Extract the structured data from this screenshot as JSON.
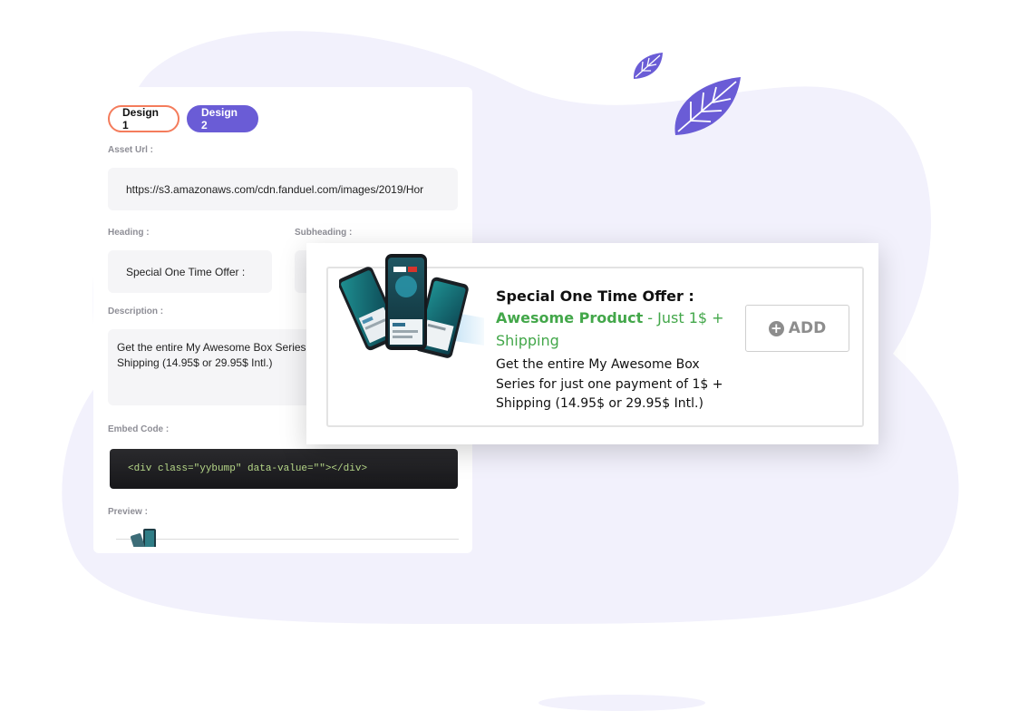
{
  "colors": {
    "accent_purple": "#6a5cd6",
    "tab_outline": "#f47c5c",
    "offer_green": "#43a74a",
    "blob_background": "#f2f1fc"
  },
  "editor": {
    "tabs": [
      {
        "label": "Design 1",
        "active": false
      },
      {
        "label": "Design 2",
        "active": true
      }
    ],
    "asset_url": {
      "label": "Asset Url :",
      "value": "https://s3.amazonaws.com/cdn.fanduel.com/images/2019/Hor"
    },
    "heading": {
      "label": "Heading :",
      "value": "Special One Time Offer :"
    },
    "subheading": {
      "label": "Subheading :"
    },
    "description": {
      "label": "Description :",
      "value": "Get the entire My Awesome Box Series for just one payment of 1$ + Shipping (14.95$ or 29.95$ Intl.)"
    },
    "embed_code": {
      "label": "Embed Code :",
      "value": "<div class=\"yybump\" data-value=\"\"></div>"
    },
    "preview": {
      "label": "Preview :"
    }
  },
  "offer": {
    "heading": "Special One Time Offer :",
    "product": "Awesome Product",
    "price_text": " - Just 1$ + Shipping",
    "description": "Get the entire My Awesome Box Series for just one payment of 1$ + Shipping (14.95$ or 29.95$ Intl.)",
    "add_button": {
      "label": "ADD",
      "icon": "plus-circle-icon"
    },
    "image_icon": "phones-product-image"
  },
  "decorations": [
    "leaf-icon",
    "leaf-icon"
  ]
}
